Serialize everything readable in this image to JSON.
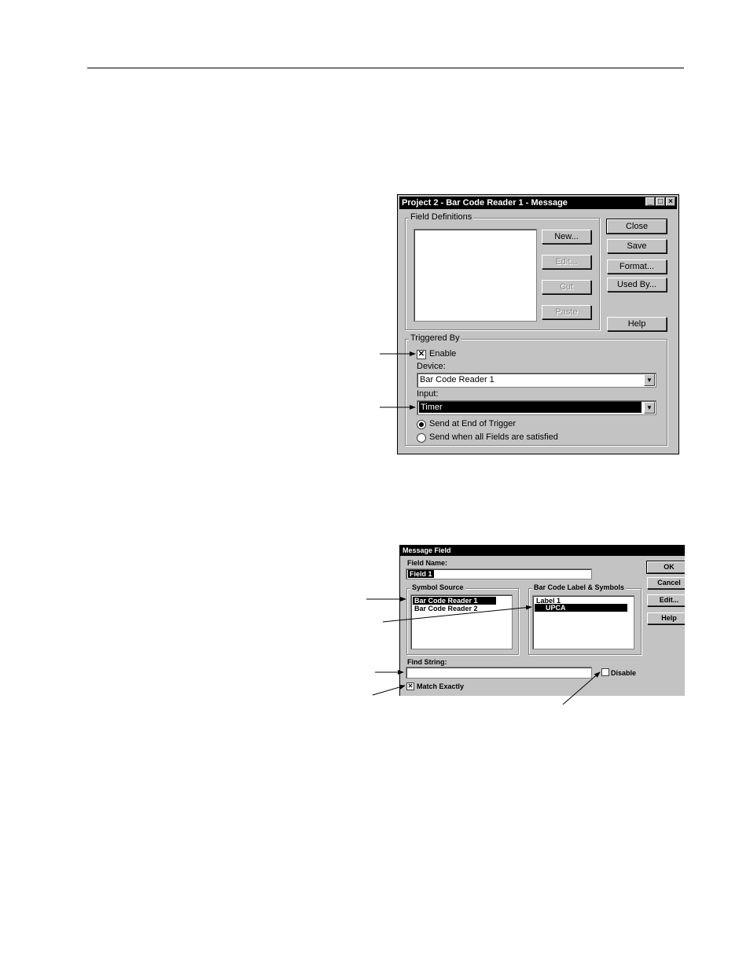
{
  "dialog1": {
    "title": "Project 2 - Bar Code Reader 1 - Message",
    "title_buttons": [
      "_",
      "□",
      "×"
    ],
    "field_definitions": {
      "label": "Field Definitions",
      "buttons": {
        "new": "New...",
        "edit": "Edit...",
        "cut": "Cut",
        "paste": "Paste"
      }
    },
    "side_buttons": {
      "close": "Close",
      "save": "Save",
      "format": "Format...",
      "used_by": "Used By...",
      "help": "Help"
    },
    "triggered_by": {
      "label": "Triggered By",
      "enable_label": "Enable",
      "enable_checked": true,
      "device_label": "Device:",
      "device_value": "Bar Code Reader 1",
      "input_label": "Input:",
      "input_value": "Timer",
      "radio_end_label": "Send at End of Trigger",
      "radio_all_label": "Send when all Fields are satisfied",
      "selected_radio": "end"
    }
  },
  "dialog2": {
    "title": "Message Field",
    "field_name_label": "Field Name:",
    "field_name_value": "Field 1",
    "symbol_source_label": "Symbol Source",
    "symbol_sources": [
      "Bar Code Reader 1",
      "Bar Code Reader 2"
    ],
    "symbol_label_group": "Bar Code Label & Symbols",
    "symbol_labels": [
      "Label 1",
      "UPCA"
    ],
    "find_string_label": "Find String:",
    "disable_label": "Disable",
    "match_exactly_label": "Match Exactly",
    "buttons": {
      "ok": "OK",
      "cancel": "Cancel",
      "edit": "Edit...",
      "help": "Help"
    }
  },
  "colors": {
    "dialog_face": "#c3c3c3",
    "title_bar": "#000000",
    "selection": "#000000"
  }
}
